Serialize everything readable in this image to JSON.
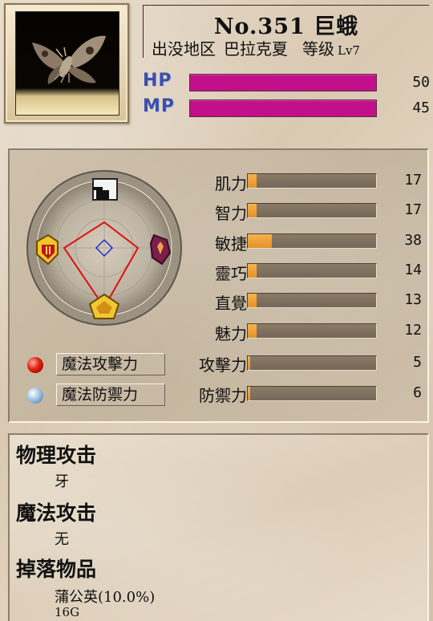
{
  "monster": {
    "title": "No.351 巨蛾",
    "area_label": "出没地区",
    "area": "巴拉克夏",
    "level_label": "等级",
    "level": "Lv7"
  },
  "vitals": {
    "hp": {
      "label": "HP",
      "value": "50",
      "fill": 1.0
    },
    "mp": {
      "label": "MP",
      "value": "45",
      "fill": 1.0
    }
  },
  "stats": [
    {
      "label": "肌力",
      "value": "17",
      "fill": 0.07
    },
    {
      "label": "智力",
      "value": "17",
      "fill": 0.07
    },
    {
      "label": "敏捷",
      "value": "38",
      "fill": 0.19
    },
    {
      "label": "靈巧",
      "value": "14",
      "fill": 0.07
    },
    {
      "label": "直覺",
      "value": "13",
      "fill": 0.07
    },
    {
      "label": "魅力",
      "value": "12",
      "fill": 0.07
    },
    {
      "label": "攻擊力",
      "value": "5",
      "fill": 0.02
    },
    {
      "label": "防禦力",
      "value": "6",
      "fill": 0.02
    }
  ],
  "magic": {
    "attack_button": "魔法攻擊力",
    "defense_button": "魔法防禦力"
  },
  "details": {
    "physical_attack": {
      "title": "物理攻击",
      "value": "牙"
    },
    "magic_attack": {
      "title": "魔法攻击",
      "value": "无"
    },
    "drops": {
      "title": "掉落物品",
      "items": [
        "蒲公英(10.0%)",
        "16G"
      ]
    }
  },
  "colors": {
    "hp_mp_bar": "#c2108a",
    "stat_fill": "#f0a63c",
    "hp_mp_label": "#3c4fa6",
    "radar_line": "#e01010"
  },
  "icons": {
    "dial_top": "dark-element-icon",
    "dial_left": "fire-element-icon",
    "dial_right": "spirit-element-icon",
    "dial_bottom": "earth-element-icon"
  }
}
